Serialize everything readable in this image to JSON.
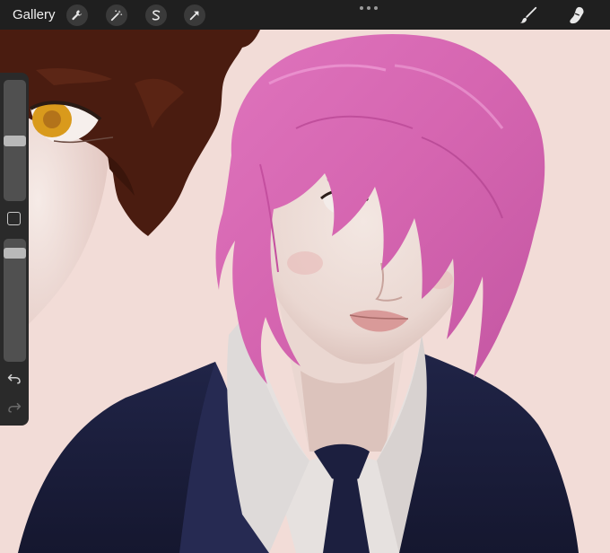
{
  "toolbar": {
    "gallery_label": "Gallery",
    "left_tools": [
      {
        "name": "actions",
        "icon": "wrench-icon"
      },
      {
        "name": "adjustments",
        "icon": "magic-wand-icon"
      },
      {
        "name": "selection",
        "icon": "selection-s-icon"
      },
      {
        "name": "transform",
        "icon": "arrow-cursor-icon"
      }
    ],
    "more_icon": "more-dots-icon",
    "right_tools": [
      {
        "name": "brush",
        "icon": "brush-icon"
      },
      {
        "name": "smudge",
        "icon": "smudge-finger-icon"
      }
    ],
    "bar_color": "#1f1f1f"
  },
  "sidebar": {
    "brush_size_level": 0.5,
    "opacity_level": 0.08,
    "modify_icon": "square-modify-icon",
    "undo_icon": "undo-icon",
    "redo_icon": "redo-icon"
  },
  "canvas": {
    "background_color": "#f2dcd7",
    "hair_pink": "#d86bb6",
    "hair_brown": "#4a1c10",
    "suit_navy": "#1c1f3f",
    "shirt_white": "#e6e1df",
    "skin_tone": "#ecd8d3",
    "eye_amber": "#d99a1c"
  }
}
